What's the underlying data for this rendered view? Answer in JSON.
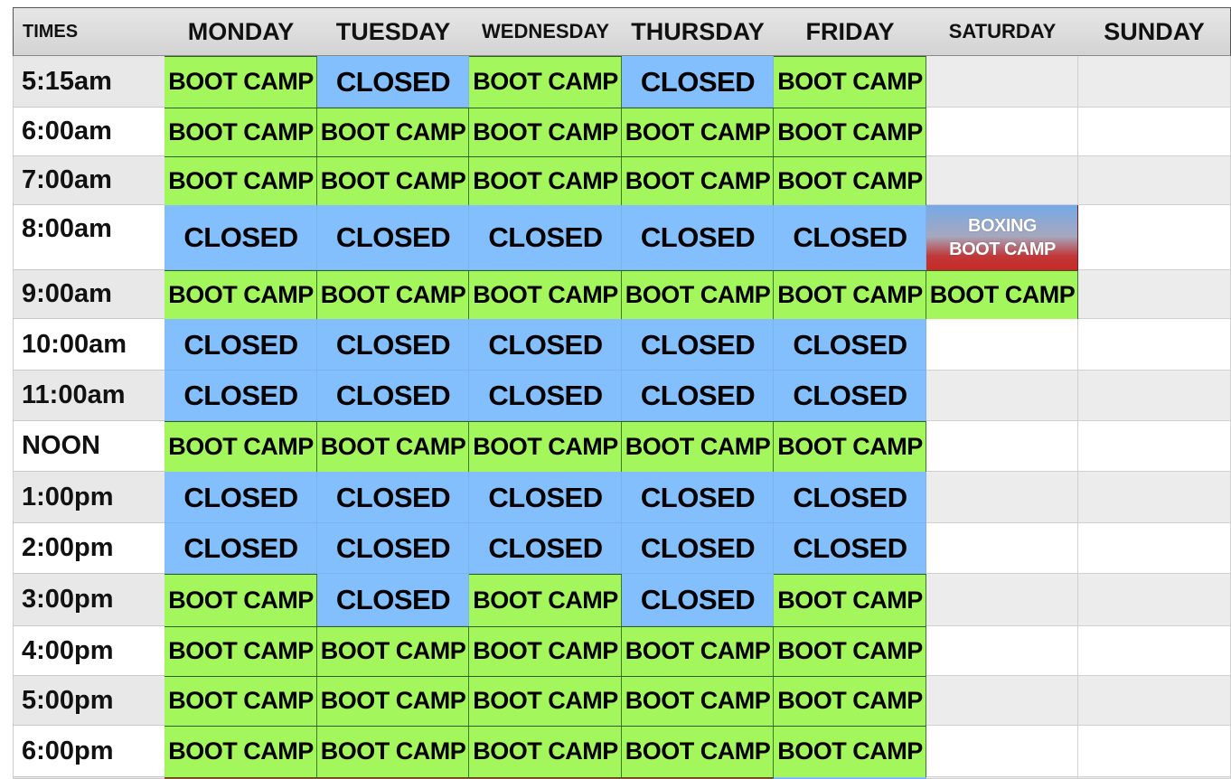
{
  "headers": [
    "TIMES",
    "MONDAY",
    "TUESDAY",
    "WEDNESDAY",
    "THURSDAY",
    "FRIDAY",
    "SATURDAY",
    "SUNDAY"
  ],
  "labels": {
    "boot_camp": "BOOT CAMP",
    "closed": "CLOSED",
    "boxing_line1": "BOXING",
    "boxing_line2": "BOOT CAMP"
  },
  "colors": {
    "boot_camp": "#a3f65b",
    "closed": "#82bffc",
    "boxing_top": "#75a9e8",
    "boxing_bottom": "#c92926",
    "header": "#dcdcdc"
  },
  "rows": [
    {
      "time": "5:15am",
      "slots": [
        "boot_camp",
        "closed",
        "boot_camp",
        "closed",
        "boot_camp",
        "",
        ""
      ]
    },
    {
      "time": "6:00am",
      "slots": [
        "boot_camp",
        "boot_camp",
        "boot_camp",
        "boot_camp",
        "boot_camp",
        "",
        ""
      ]
    },
    {
      "time": "7:00am",
      "slots": [
        "boot_camp",
        "boot_camp",
        "boot_camp",
        "boot_camp",
        "boot_camp",
        "",
        ""
      ]
    },
    {
      "time": "8:00am",
      "slots": [
        "closed",
        "closed",
        "closed",
        "closed",
        "closed",
        "boxing",
        ""
      ]
    },
    {
      "time": "9:00am",
      "slots": [
        "boot_camp",
        "boot_camp",
        "boot_camp",
        "boot_camp",
        "boot_camp",
        "boot_camp",
        ""
      ]
    },
    {
      "time": "10:00am",
      "slots": [
        "closed",
        "closed",
        "closed",
        "closed",
        "closed",
        "",
        ""
      ]
    },
    {
      "time": "11:00am",
      "slots": [
        "closed",
        "closed",
        "closed",
        "closed",
        "closed",
        "",
        ""
      ]
    },
    {
      "time": "NOON",
      "slots": [
        "boot_camp",
        "boot_camp",
        "boot_camp",
        "boot_camp",
        "boot_camp",
        "",
        ""
      ]
    },
    {
      "time": "1:00pm",
      "slots": [
        "closed",
        "closed",
        "closed",
        "closed",
        "closed",
        "",
        ""
      ]
    },
    {
      "time": "2:00pm",
      "slots": [
        "closed",
        "closed",
        "closed",
        "closed",
        "closed",
        "",
        ""
      ]
    },
    {
      "time": "3:00pm",
      "slots": [
        "boot_camp",
        "closed",
        "boot_camp",
        "closed",
        "boot_camp",
        "",
        ""
      ]
    },
    {
      "time": "4:00pm",
      "slots": [
        "boot_camp",
        "boot_camp",
        "boot_camp",
        "boot_camp",
        "boot_camp",
        "",
        ""
      ]
    },
    {
      "time": "5:00pm",
      "slots": [
        "boot_camp",
        "boot_camp",
        "boot_camp",
        "boot_camp",
        "boot_camp",
        "",
        ""
      ]
    },
    {
      "time": "6:00pm",
      "slots": [
        "boot_camp",
        "boot_camp",
        "boot_camp",
        "boot_camp",
        "boot_camp",
        "",
        ""
      ]
    }
  ]
}
